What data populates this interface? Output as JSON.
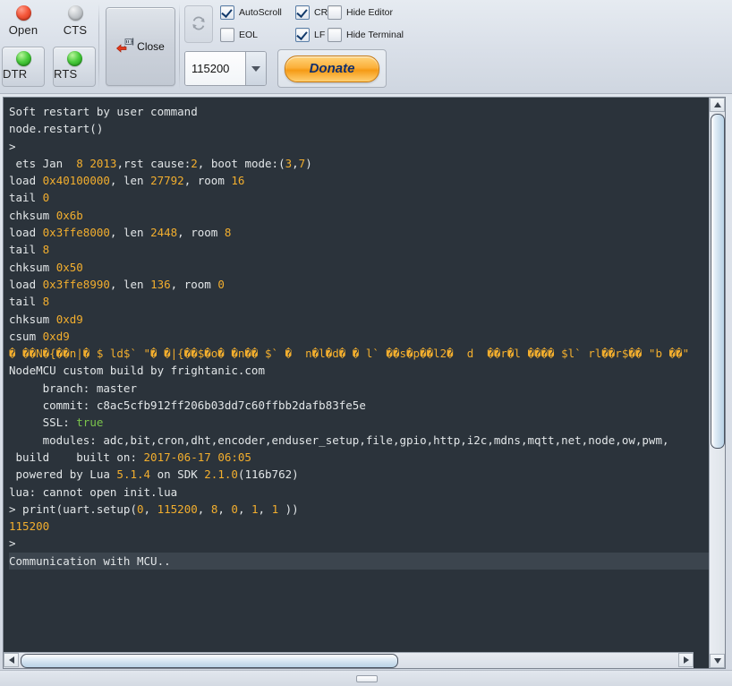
{
  "toolbar": {
    "indicators": [
      {
        "name": "open",
        "label": "Open",
        "state": "red"
      },
      {
        "name": "cts",
        "label": "CTS",
        "state": "grey"
      },
      {
        "name": "dtr",
        "label": "DTR",
        "state": "green"
      },
      {
        "name": "rts",
        "label": "RTS",
        "state": "green"
      }
    ],
    "close_button": {
      "label": "Close",
      "icon": "disconnect-plug-icon"
    },
    "refresh_button": {
      "icon": "refresh-icon",
      "enabled": false
    },
    "checkboxes": [
      {
        "name": "autoscroll",
        "label": "AutoScroll",
        "checked": true
      },
      {
        "name": "eol",
        "label": "EOL",
        "checked": false
      },
      {
        "name": "cr",
        "label": "CR",
        "checked": true
      },
      {
        "name": "lf",
        "label": "LF",
        "checked": true
      },
      {
        "name": "hide-editor",
        "label": "Hide Editor",
        "checked": false
      },
      {
        "name": "hide-terminal",
        "label": "Hide Terminal",
        "checked": false
      }
    ],
    "baud_rate": {
      "value": "115200"
    },
    "donate_button": {
      "label": "Donate"
    }
  },
  "colors": {
    "terminal_bg": "#2b333b",
    "terminal_fg": "#e2e6e8",
    "number_accent": "#f2ae2e",
    "true_accent": "#7bc44c",
    "highlight_bg": "#3c454e",
    "donate_accent": "#fbb03b",
    "scrollbar_thumb": "#c8dcec"
  },
  "terminal": {
    "lines": [
      {
        "id": "l0",
        "text": "Soft restart by user command"
      },
      {
        "id": "l1",
        "text": "node.restart()"
      },
      {
        "id": "l2",
        "text": ">"
      },
      {
        "id": "l3",
        "text": " ets Jan  8 2013,rst cause:2, boot mode:(3,7)"
      },
      {
        "id": "l4",
        "text": ""
      },
      {
        "id": "l5",
        "text": "load 0x40100000, len 27792, room 16"
      },
      {
        "id": "l6",
        "text": "tail 0"
      },
      {
        "id": "l7",
        "text": "chksum 0x6b"
      },
      {
        "id": "l8",
        "text": "load 0x3ffe8000, len 2448, room 8"
      },
      {
        "id": "l9",
        "text": "tail 8"
      },
      {
        "id": "l10",
        "text": "chksum 0x50"
      },
      {
        "id": "l11",
        "text": "load 0x3ffe8990, len 136, room 0"
      },
      {
        "id": "l12",
        "text": "tail 8"
      },
      {
        "id": "l13",
        "text": "chksum 0xd9"
      },
      {
        "id": "l14",
        "text": "csum 0xd9"
      },
      {
        "id": "l15",
        "text": "\u0000 \u0000\u0000N\u0000{\u0000\u0000n|\u0000 $ ld$` \"\u0000 \u0000|{\u0000\u0000$\u0000o\u0000 \u0000n\u0000\u0000 $` \u0000  n\u0000l\u0000d\u0000 \u0000 l` \u0000\u0000s\u0000p\u0000\u0000l2\u0000  d  \u0000\u0000r\u0000l \u0000\u0000\u0000\u0000 $l` rl\u0000\u0000r$\u0000\u0000 \"b \u0000\u0000\""
      },
      {
        "id": "l16",
        "text": ""
      },
      {
        "id": "l17",
        "text": ""
      },
      {
        "id": "l18",
        "text": "NodeMCU custom build by frightanic.com"
      },
      {
        "id": "l19",
        "text": "     branch: master"
      },
      {
        "id": "l20",
        "text": "     commit: c8ac5cfb912ff206b03dd7c60ffbb2dafb83fe5e"
      },
      {
        "id": "l21",
        "text": "     SSL: true"
      },
      {
        "id": "l22",
        "text": "     modules: adc,bit,cron,dht,encoder,enduser_setup,file,gpio,http,i2c,mdns,mqtt,net,node,ow,pwm,"
      },
      {
        "id": "l23",
        "text": " build    built on: 2017-06-17 06:05"
      },
      {
        "id": "l24",
        "text": " powered by Lua 5.1.4 on SDK 2.1.0(116b762)"
      },
      {
        "id": "l25",
        "text": "lua: cannot open init.lua"
      },
      {
        "id": "l26",
        "text": "> print(uart.setup(0, 115200, 8, 0, 1, 1 ))"
      },
      {
        "id": "l27",
        "text": "115200"
      },
      {
        "id": "l28",
        "text": ">"
      },
      {
        "id": "l29",
        "text": "Communication with MCU.."
      }
    ]
  }
}
